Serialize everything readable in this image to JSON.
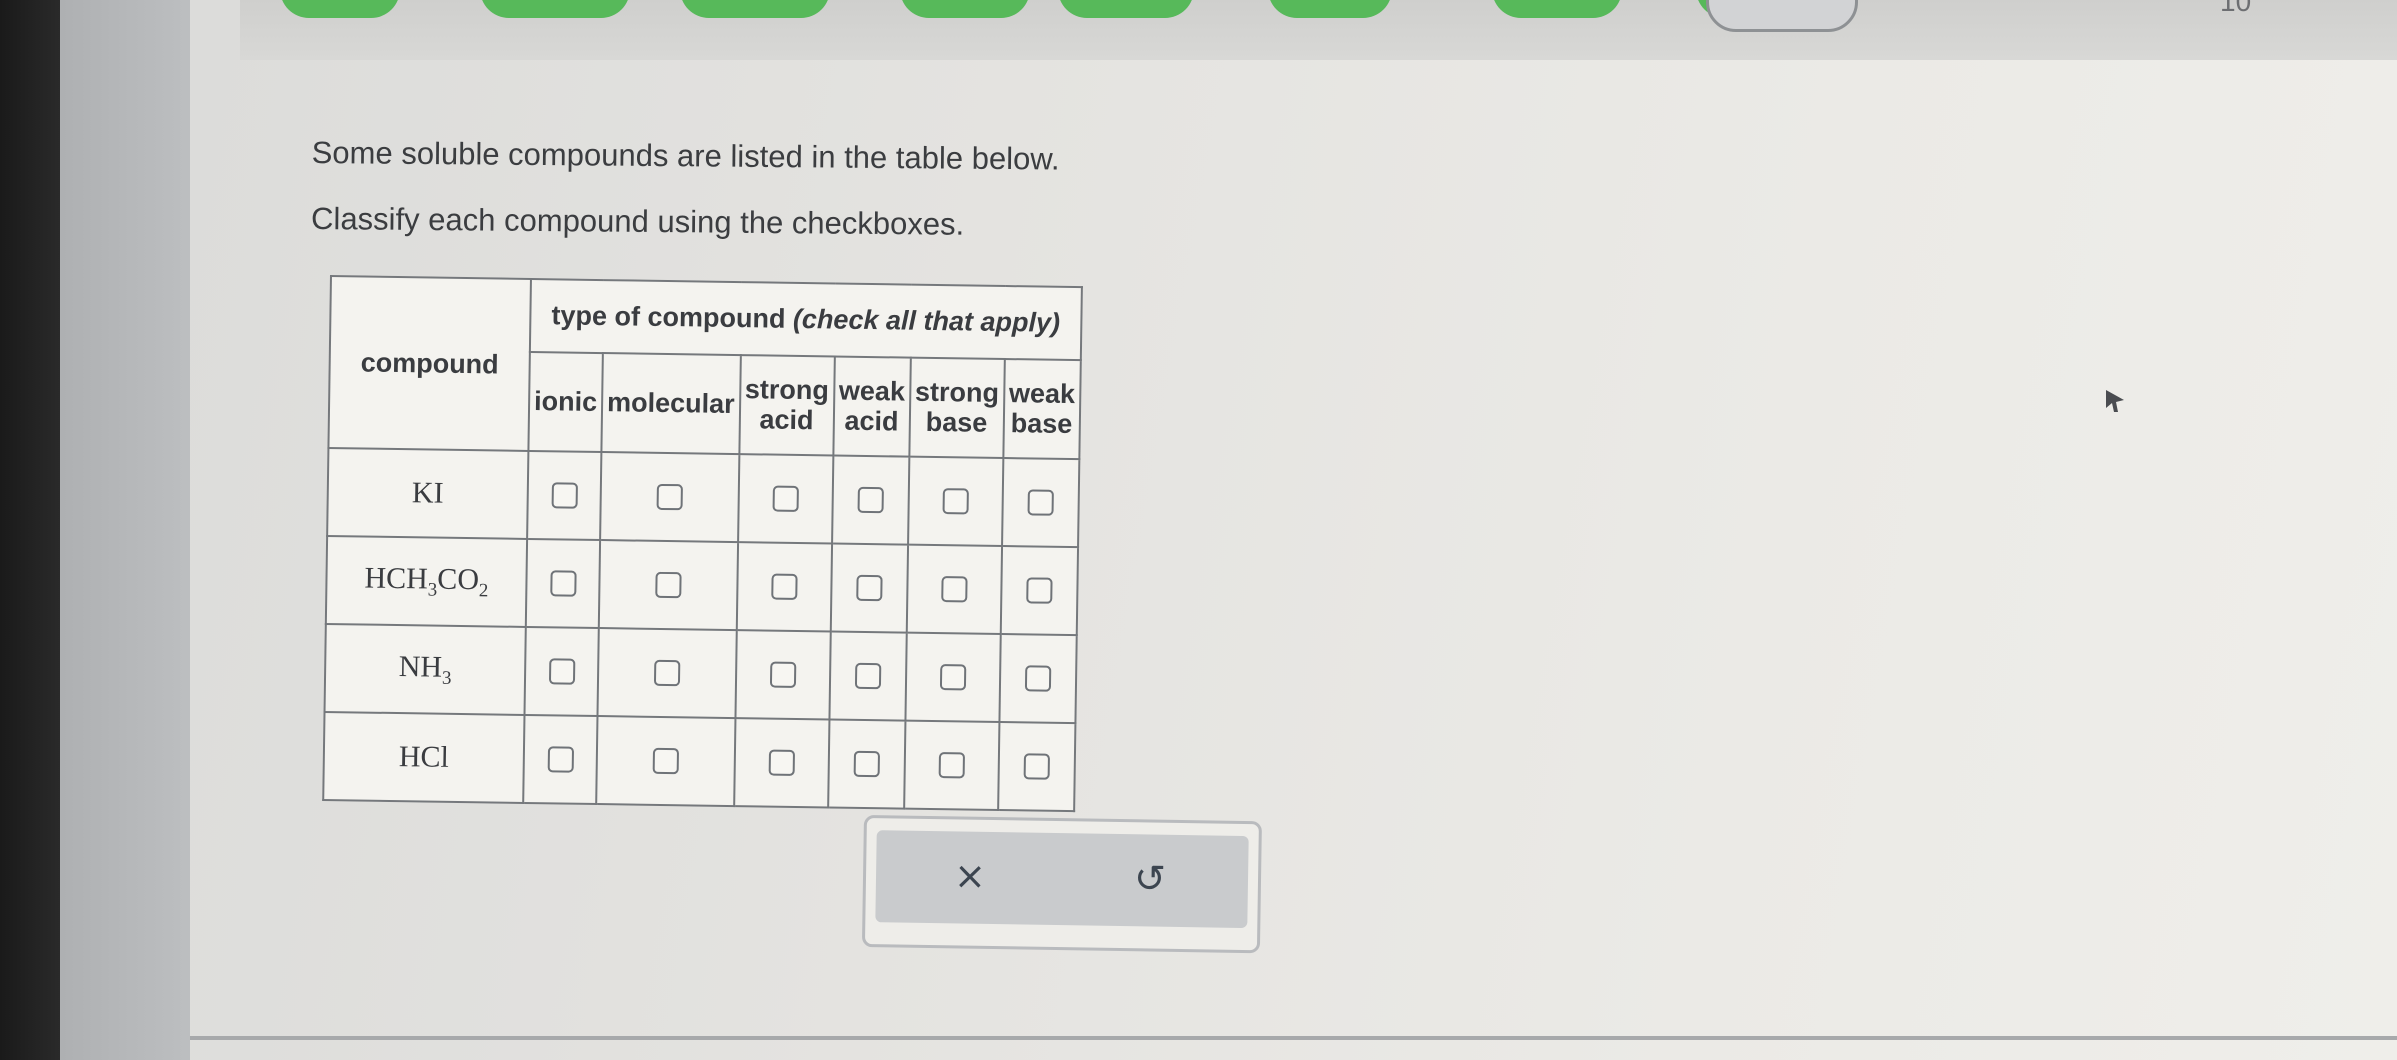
{
  "question": {
    "intro": "Some soluble compounds are listed in the table below.",
    "instruction": "Classify each compound using the checkboxes."
  },
  "table": {
    "compound_header": "compound",
    "type_header_prefix": "type of compound ",
    "type_header_suffix": "(check all that apply)",
    "columns": [
      {
        "line1": "ionic",
        "line2": ""
      },
      {
        "line1": "molecular",
        "line2": ""
      },
      {
        "line1": "strong",
        "line2": "acid"
      },
      {
        "line1": "weak",
        "line2": "acid"
      },
      {
        "line1": "strong",
        "line2": "base"
      },
      {
        "line1": "weak",
        "line2": "base"
      }
    ],
    "rows": [
      {
        "formula": [
          {
            "t": "KI",
            "sub": ""
          }
        ],
        "checked": [
          false,
          false,
          false,
          false,
          false,
          false
        ]
      },
      {
        "formula": [
          {
            "t": "HCH",
            "sub": "3"
          },
          {
            "t": "CO",
            "sub": "2"
          }
        ],
        "checked": [
          false,
          false,
          false,
          false,
          false,
          false
        ]
      },
      {
        "formula": [
          {
            "t": "NH",
            "sub": "3"
          }
        ],
        "checked": [
          false,
          false,
          false,
          false,
          false,
          false
        ]
      },
      {
        "formula": [
          {
            "t": "HCl",
            "sub": ""
          }
        ],
        "checked": [
          false,
          false,
          false,
          false,
          false,
          false
        ]
      }
    ]
  },
  "actions": {
    "clear_symbol": "×",
    "undo_symbol": "↺"
  },
  "header": {
    "partial_number": "10"
  },
  "colors": {
    "progress_green": "#57b95a",
    "text": "#3a3c40"
  }
}
